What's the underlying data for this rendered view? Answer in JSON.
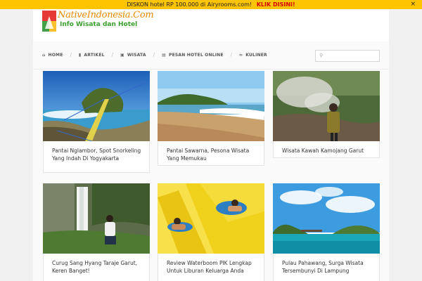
{
  "promo": {
    "text": "DISKON hotel RP 100.000 di Airyrooms.com!",
    "cta": "KLIK DISINI!",
    "close": "×"
  },
  "logo": {
    "title": "NativeIndonesia.Com",
    "subtitle": "Info Wisata dan Hotel"
  },
  "nav": {
    "items": [
      {
        "label": "HOME",
        "icon": "home-icon",
        "glyph": "⌂"
      },
      {
        "label": "ARTIKEL",
        "icon": "book-icon",
        "glyph": "▮"
      },
      {
        "label": "WISATA",
        "icon": "image-icon",
        "glyph": "▣"
      },
      {
        "label": "PESAN HOTEL ONLINE",
        "icon": "calendar-icon",
        "glyph": "▤"
      },
      {
        "label": "KULINER",
        "icon": "link-icon",
        "glyph": "∞"
      }
    ],
    "separator": "/"
  },
  "search": {
    "placeholder": "",
    "value": ""
  },
  "posts": [
    {
      "title": "Pantai Nglambor, Spot Snorkeling Yang Indah Di Yogyakarta"
    },
    {
      "title": "Pantai Sawarna, Pesona Wisata Yang Memukau"
    },
    {
      "title": "Wisata Kawah Kamojang Garut"
    },
    {
      "title": "Curug Sang Hyang Taraje Garut, Keren Banget!"
    },
    {
      "title": "Review Waterboom PIK Lengkap Untuk Liburan Keluarga Anda"
    },
    {
      "title": "Pulau Pahawang, Surga Wisata Tersembunyi Di Lampung"
    }
  ],
  "colors": {
    "promo_bg": "#ffc400",
    "cta": "#d40000",
    "logo_orange": "#e88a00",
    "logo_green": "#3a9f2e"
  }
}
